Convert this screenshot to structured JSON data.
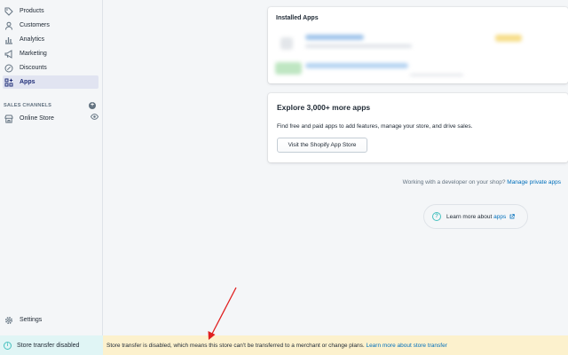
{
  "sidebar": {
    "items": [
      {
        "label": "Products",
        "icon": "tag-icon"
      },
      {
        "label": "Customers",
        "icon": "person-icon"
      },
      {
        "label": "Analytics",
        "icon": "bar-chart-icon"
      },
      {
        "label": "Marketing",
        "icon": "megaphone-icon"
      },
      {
        "label": "Discounts",
        "icon": "discount-icon"
      },
      {
        "label": "Apps",
        "icon": "apps-icon",
        "active": true
      }
    ],
    "sales_channels_title": "SALES CHANNELS",
    "online_store_label": "Online Store",
    "settings_label": "Settings",
    "transfer_status_label": "Store transfer disabled"
  },
  "installed_apps": {
    "title": "Installed Apps"
  },
  "explore": {
    "title": "Explore 3,000+ more apps",
    "description": "Find free and paid apps to add features, manage your store, and drive sales.",
    "button_label": "Visit the Shopify App Store"
  },
  "developer": {
    "text": "Working with a developer on your shop?",
    "link": "Manage private apps"
  },
  "learn_more": {
    "text": "Learn more about",
    "link": "apps"
  },
  "banner": {
    "text": "Store transfer is disabled, which means this store can't be transferred to a merchant or change plans.",
    "link": "Learn more about store transfer"
  },
  "colors": {
    "active_nav_bg": "#e1e4f1",
    "banner_bg": "#fcf1cd",
    "link": "#006fbb",
    "annotation_arrow": "#e02020"
  }
}
